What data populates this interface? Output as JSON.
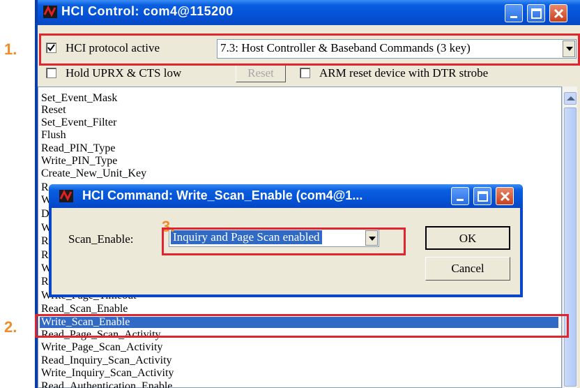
{
  "window": {
    "title": "HCI Control: com4@115200"
  },
  "toolbar": {
    "hci_active_label": "HCI protocol active",
    "hci_active_checked": true,
    "command_set_value": "7.3: Host Controller & Baseband Commands (3 key)",
    "hold_uprx_label": "Hold UPRX & CTS low",
    "hold_uprx_checked": false,
    "reset_label": "Reset",
    "arm_reset_label": "ARM reset device with DTR strobe",
    "arm_reset_checked": false
  },
  "command_list": [
    {
      "label": "Set_Event_Mask"
    },
    {
      "label": "Reset"
    },
    {
      "label": "Set_Event_Filter"
    },
    {
      "label": "Flush"
    },
    {
      "label": "Read_PIN_Type"
    },
    {
      "label": "Write_PIN_Type"
    },
    {
      "label": "Create_New_Unit_Key"
    },
    {
      "label": "R"
    },
    {
      "label": "W"
    },
    {
      "label": "D"
    },
    {
      "label": "W"
    },
    {
      "label": "R"
    },
    {
      "label": "R"
    },
    {
      "label": "W"
    },
    {
      "label": "R"
    },
    {
      "label": "Write_Page_Timeout"
    },
    {
      "label": "Read_Scan_Enable"
    },
    {
      "label": "Write_Scan_Enable",
      "selected": true
    },
    {
      "label": "Read_Page_Scan_Activity"
    },
    {
      "label": "Write_Page_Scan_Activity"
    },
    {
      "label": "Read_Inquiry_Scan_Activity"
    },
    {
      "label": "Write_Inquiry_Scan_Activity"
    },
    {
      "label": "Read_Authentication_Enable"
    }
  ],
  "dialog": {
    "title": "HCI Command: Write_Scan_Enable (com4@1...",
    "field_label": "Scan_Enable:",
    "field_value": "Inquiry and Page Scan enabled",
    "ok_label": "OK",
    "cancel_label": "Cancel"
  },
  "annotations": {
    "step1": "1.",
    "step2": "2.",
    "step3": "3."
  },
  "colors": {
    "title_bar": "#0552d6",
    "selection": "#316ac5",
    "annotation_box": "#e0252f",
    "annotation_number": "#ef8c2a"
  }
}
